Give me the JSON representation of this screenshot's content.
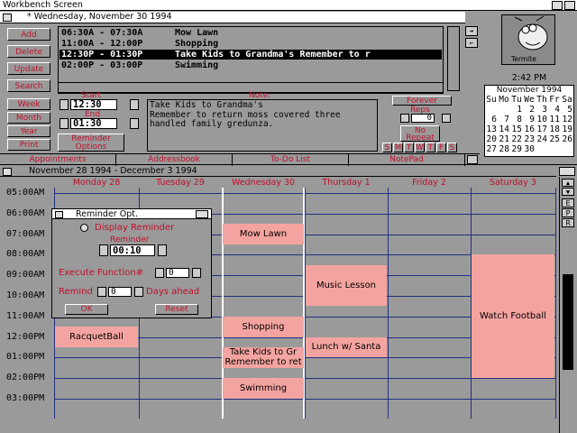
{
  "screen": {
    "title": "Workbench Screen"
  },
  "window": {
    "title": "* Wednesday, November 30 1994"
  },
  "left_buttons": [
    "Add",
    "Delete",
    "Update",
    "Search"
  ],
  "view_buttons": [
    "Week",
    "Month",
    "Year",
    "Print"
  ],
  "appointments": [
    {
      "time": "06:30A - 07:30A",
      "text": "Mow Lawn",
      "selected": false
    },
    {
      "time": "11:00A - 12:00P",
      "text": "Shopping",
      "selected": false
    },
    {
      "time": "12:30P - 01:30P",
      "text": "Take Kids to Grandma's Remember to r",
      "selected": true
    },
    {
      "time": "02:00P - 03:00P",
      "text": "Swimming",
      "selected": false
    }
  ],
  "start": {
    "label": "Start",
    "value": "12:30"
  },
  "end": {
    "label": "End",
    "value": "01:30"
  },
  "reminder_options_label": "Reminder Options",
  "note": {
    "label": "Note:",
    "text": "Take Kids to Grandma's\nRemember to return moss covered three\nhandled family gredunza."
  },
  "forever_label": "Forever",
  "reps_label": "Reps",
  "reps_value": "0",
  "no_repeat_label": "No Repeat",
  "weekday_letters": [
    "S",
    "M",
    "T",
    "W",
    "T",
    "F",
    "S"
  ],
  "tabs": [
    "Appointments",
    "Addressbook",
    "To-Do List",
    "NotePad"
  ],
  "clock": "2:42 PM",
  "termite_label": "Termite",
  "mini_calendar": {
    "month": "November 1994",
    "headers": [
      "Su",
      "Mo",
      "Tu",
      "We",
      "Th",
      "Fr",
      "Sa"
    ],
    "rows": [
      [
        "",
        "",
        "1",
        "2",
        "3",
        "4",
        "5"
      ],
      [
        "6",
        "7",
        "8",
        "9",
        "10",
        "11",
        "12"
      ],
      [
        "13",
        "14",
        "15",
        "16",
        "17",
        "18",
        "19"
      ],
      [
        "20",
        "21",
        "22",
        "23",
        "24",
        "25",
        "26"
      ],
      [
        "27",
        "28",
        "29",
        "30",
        "",
        "",
        ""
      ]
    ]
  },
  "week": {
    "title": "November 28 1994 - December 3 1994",
    "days": [
      "Monday 28",
      "Tuesday 29",
      "Wednesday 30",
      "Thursday 1",
      "Friday 2",
      "Saturday 3"
    ],
    "hours": [
      "05:00AM",
      "06:00AM",
      "07:00AM",
      "08:00AM",
      "09:00AM",
      "10:00AM",
      "11:00AM",
      "12:00PM",
      "01:00PM",
      "02:00PM",
      "03:00PM"
    ],
    "events": [
      {
        "day": 2,
        "start": 6.5,
        "end": 7.5,
        "label": "Mow Lawn"
      },
      {
        "day": 2,
        "start": 11.0,
        "end": 12.0,
        "label": "Shopping"
      },
      {
        "day": 2,
        "start": 12.5,
        "end": 13.5,
        "label": "Take Kids to Gr\nRemember to ret"
      },
      {
        "day": 2,
        "start": 14.0,
        "end": 15.0,
        "label": "Swimming"
      },
      {
        "day": 3,
        "start": 8.5,
        "end": 10.5,
        "label": "Music Lesson"
      },
      {
        "day": 3,
        "start": 12.0,
        "end": 13.0,
        "label": "Lunch w/ Santa"
      },
      {
        "day": 0,
        "start": 11.5,
        "end": 12.5,
        "label": "RacquetBall"
      },
      {
        "day": 5,
        "start": 8.0,
        "end": 14.0,
        "label": "Watch Football"
      }
    ],
    "scroll_letters": [
      "E",
      "P",
      "R"
    ]
  },
  "reminder_dialog": {
    "title": "Reminder Opt.",
    "display_label": "Display Reminder",
    "reminder_label": "Reminder",
    "reminder_value": "00:10",
    "execute_label": "Execute Function#",
    "execute_value": "0",
    "remind_label": "Remind",
    "remind_value": "0",
    "days_ahead_label": "Days ahead",
    "ok_label": "OK",
    "reset_label": "Reset"
  }
}
